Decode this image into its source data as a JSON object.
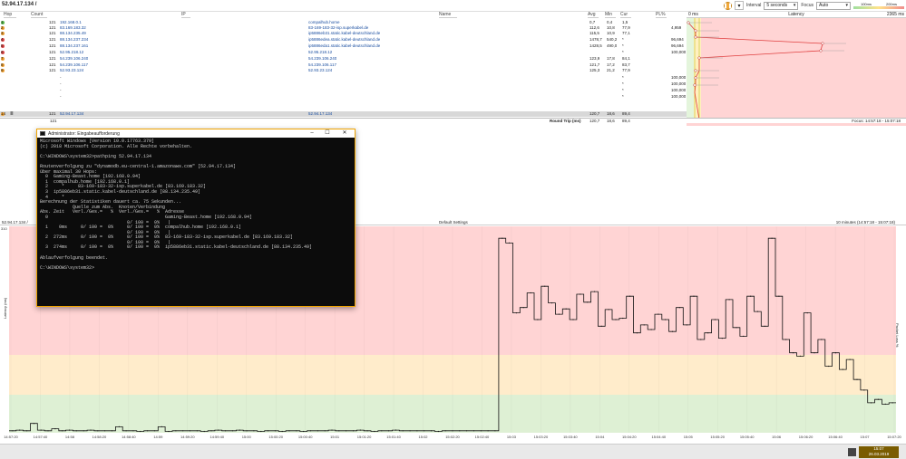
{
  "header": {
    "target": "52.94.17.134 /",
    "interval_label": "Interval",
    "interval_value": "5 seconds",
    "focus_label": "Focus",
    "focus_value": "Auto",
    "legend_ms_low": "100ms",
    "legend_ms_high": "200ms"
  },
  "columns": {
    "hop": "Hop",
    "count": "Count",
    "ip": "IP",
    "name": "Name",
    "avg": "Avg",
    "min": "Min",
    "cur": "Cur",
    "pl": "PL%",
    "lat_min": "0 ms",
    "latency": "Latency",
    "lat_max": "2365 ms"
  },
  "hops": [
    {
      "hop": "1",
      "count": "121",
      "ip": "192.168.0.1",
      "name": "compalhub.home",
      "avg": "0,7",
      "min": "0,4",
      "cur": "1,5",
      "pl": "",
      "status": "green"
    },
    {
      "hop": "2",
      "count": "121",
      "ip": "83.169.183.32",
      "name": "83-169-183-32-isp.superkabel.de",
      "avg": "112,6",
      "min": "10,8",
      "cur": "77,9",
      "pl": "4,959",
      "status": "orange"
    },
    {
      "hop": "3",
      "count": "121",
      "ip": "88.134.235.49",
      "name": "ip5886eb31.static.kabel-deutschland.de",
      "avg": "115,5",
      "min": "10,9",
      "cur": "77,1",
      "pl": "",
      "status": "orange"
    },
    {
      "hop": "4",
      "count": "121",
      "ip": "88.134.237.234",
      "name": "ip5886edea.static.kabel-deutschland.de",
      "avg": "1478,7",
      "min": "540,2",
      "cur": "*",
      "pl": "96,694",
      "status": "red"
    },
    {
      "hop": "5",
      "count": "121",
      "ip": "88.134.237.161",
      "name": "ip5886eda1.static.kabel-deutschland.de",
      "avg": "1428,5",
      "min": "490,0",
      "cur": "*",
      "pl": "96,694",
      "status": "red"
    },
    {
      "hop": "6",
      "count": "121",
      "ip": "52.95.218.12",
      "name": "52.95.218.12",
      "avg": "",
      "min": "",
      "cur": "*",
      "pl": "100,000",
      "status": "red"
    },
    {
      "hop": "7",
      "count": "121",
      "ip": "54.239.106.240",
      "name": "54.239.106.240",
      "avg": "123,9",
      "min": "17,8",
      "cur": "84,1",
      "pl": "",
      "status": "orange"
    },
    {
      "hop": "8",
      "count": "121",
      "ip": "54.239.106.117",
      "name": "54.239.106.117",
      "avg": "121,7",
      "min": "17,2",
      "cur": "83,7",
      "pl": "",
      "status": "orange"
    },
    {
      "hop": "9",
      "count": "121",
      "ip": "52.93.23.124",
      "name": "52.93.23.124",
      "avg": "125,3",
      "min": "21,2",
      "cur": "77,9",
      "pl": "",
      "status": "orange"
    },
    {
      "hop": "",
      "count": "",
      "ip": "-",
      "name": "",
      "avg": "",
      "min": "",
      "cur": "*",
      "pl": "100,000",
      "status": ""
    },
    {
      "hop": "",
      "count": "",
      "ip": "-",
      "name": "",
      "avg": "",
      "min": "",
      "cur": "*",
      "pl": "100,000",
      "status": ""
    },
    {
      "hop": "",
      "count": "",
      "ip": "-",
      "name": "",
      "avg": "",
      "min": "",
      "cur": "*",
      "pl": "100,000",
      "status": ""
    },
    {
      "hop": "",
      "count": "",
      "ip": "-",
      "name": "",
      "avg": "",
      "min": "",
      "cur": "*",
      "pl": "100,000",
      "status": ""
    },
    {
      "hop": "14",
      "count": "121",
      "ip": "52.94.17.134",
      "name": "52.94.17.134",
      "avg": "120,7",
      "min": "18,6",
      "cur": "89,4",
      "pl": "",
      "status": "orange"
    }
  ],
  "summary": {
    "count": "121",
    "label": "Round Trip (ms)",
    "avg": "120,7",
    "min": "18,6",
    "cur": "89,4",
    "focus": "Focus: 14:57:18 - 15:07:18"
  },
  "console": {
    "title": "Administrator: Eingabeaufforderung",
    "lines": [
      "Microsoft Windows [Version 10.0.17763.379]",
      "(c) 2018 Microsoft Corporation. Alle Rechte vorbehalten.",
      "",
      "C:\\WINDOWS\\system32>pathping 52.94.17.134",
      "",
      "Routenverfolgung zu \"dynamodb.eu-central-1.amazonaws.com\" [52.94.17.134]",
      "über maximal 30 Hops:",
      "  0  Gaming-Beast.home [192.168.0.94]",
      "  1  compalhub.home [192.168.0.1]",
      "  2     *     83-169-183-32-isp.superkabel.de [83.169.183.32]",
      "  3  ip5886eb31.static.kabel-deutschland.de [88.134.235.49]",
      "  4     *",
      "Berechnung der Statistiken dauert ca. 75 Sekunden...",
      "            Quelle zum Abs.  Knoten/Verbindung",
      "Abs. Zeit   Verl./Ges.=   %  Verl./Ges.=   %  Adresse",
      "  0                                           Gaming-Beast.home [192.168.0.94]",
      "                                0/ 100 =  0%   |",
      "  1    0ms     0/ 100 =  0%     0/ 100 =  0%  compalhub.home [192.168.0.1]",
      "                                0/ 100 =  0%   |",
      "  2  272ms     0/ 100 =  0%     0/ 100 =  0%  83-169-183-32-isp.superkabel.de [83.169.183.32]",
      "                                0/ 100 =  0%   |",
      "  3  274ms     0/ 100 =  0%     0/ 100 =  0%  ip5886eb31.static.kabel-deutschland.de [88.134.235.49]",
      "",
      "Ablaufverfolgung beendet.",
      "",
      "C:\\WINDOWS\\system32>"
    ]
  },
  "graph": {
    "target": "52.94.17.134 /",
    "settings": "Default Settings",
    "timespan": "10 minutes (14:57:18 - 15:07:18)",
    "ylabel": "Latency (ms)",
    "y2label": "Packet Loss %",
    "ytop": "310",
    "xticks": [
      "14:57:20",
      "14:57:40",
      "14:58",
      "14:58:20",
      "14:58:40",
      "14:59",
      "14:59:20",
      "14:59:40",
      "15:00",
      "15:00:20",
      "15:00:40",
      "15:01",
      "15:01:20",
      "15:01:40",
      "15:02",
      "15:02:20",
      "15:02:40",
      "15:03",
      "15:03:20",
      "15:03:40",
      "15:04",
      "15:04:20",
      "15:04:40",
      "15:05",
      "15:05:20",
      "15:05:40",
      "15:06",
      "15:06:20",
      "15:06:40",
      "15:07",
      "15:07:20"
    ]
  },
  "chart_data": {
    "type": "line",
    "ylim": [
      0,
      310
    ],
    "x": [
      "14:57:18",
      "14:57:23",
      "14:57:28",
      "14:57:33",
      "14:57:38",
      "14:57:43",
      "14:57:48",
      "14:57:53",
      "14:57:58",
      "14:58:03",
      "14:58:08",
      "14:58:13",
      "14:58:18",
      "14:58:23",
      "14:58:28",
      "14:58:33",
      "14:58:38",
      "14:58:43",
      "14:58:48",
      "14:58:53",
      "14:58:58",
      "14:59:03",
      "14:59:08",
      "14:59:13",
      "14:59:18",
      "14:59:23",
      "14:59:28",
      "14:59:33",
      "14:59:38",
      "14:59:43",
      "14:59:48",
      "14:59:53",
      "14:59:58",
      "15:00:03",
      "15:00:08",
      "15:00:13",
      "15:00:18",
      "15:00:23",
      "15:00:28",
      "15:00:33",
      "15:00:38",
      "15:00:43",
      "15:00:48",
      "15:00:53",
      "15:00:58",
      "15:01:03",
      "15:01:08",
      "15:01:13",
      "15:01:18",
      "15:01:23",
      "15:01:28",
      "15:01:33",
      "15:01:38",
      "15:01:43",
      "15:01:48",
      "15:01:53",
      "15:01:58",
      "15:02:03",
      "15:02:08",
      "15:02:13",
      "15:02:18",
      "15:02:23",
      "15:02:28",
      "15:02:33",
      "15:02:38",
      "15:02:43",
      "15:02:48",
      "15:02:53",
      "15:02:58",
      "15:03:03",
      "15:03:08",
      "15:03:13",
      "15:03:18",
      "15:03:23",
      "15:03:28",
      "15:03:33",
      "15:03:38",
      "15:03:43",
      "15:03:48",
      "15:03:53",
      "15:03:58",
      "15:04:03",
      "15:04:08",
      "15:04:13",
      "15:04:18",
      "15:04:23",
      "15:04:28",
      "15:04:33",
      "15:04:38",
      "15:04:43",
      "15:04:48",
      "15:04:53",
      "15:04:58",
      "15:05:03",
      "15:05:08",
      "15:05:13",
      "15:05:18",
      "15:05:23",
      "15:05:28",
      "15:05:33",
      "15:05:38",
      "15:05:43",
      "15:05:48",
      "15:05:53",
      "15:05:58",
      "15:06:03",
      "15:06:08",
      "15:06:13",
      "15:06:18",
      "15:06:23",
      "15:06:28",
      "15:06:33",
      "15:06:38",
      "15:06:43",
      "15:06:48",
      "15:06:53",
      "15:06:58",
      "15:07:03",
      "15:07:08",
      "15:07:13",
      "15:07:18"
    ],
    "series": [
      {
        "values": [
          3,
          4,
          3,
          14,
          4,
          3,
          6,
          3,
          4,
          3,
          3,
          4,
          3,
          3,
          3,
          9,
          3,
          3,
          2,
          3,
          3,
          9,
          2,
          3,
          3,
          3,
          3,
          2,
          3,
          4,
          3,
          3,
          4,
          3,
          3,
          2,
          3,
          3,
          2,
          3,
          3,
          2,
          3,
          3,
          3,
          4,
          3,
          3,
          3,
          4,
          3,
          2,
          3,
          3,
          4,
          3,
          3,
          3,
          3,
          3,
          2,
          3,
          3,
          3,
          3,
          3,
          3,
          3,
          3,
          292,
          285,
          180,
          188,
          210,
          170,
          220,
          195,
          178,
          186,
          170,
          208,
          196,
          212,
          160,
          185,
          170,
          172,
          205,
          150,
          162,
          155,
          178,
          170,
          152,
          188,
          162,
          205,
          140,
          150,
          170,
          142,
          200,
          158,
          145,
          205,
          182,
          160,
          292,
          205,
          140,
          120,
          115,
          180,
          120,
          140,
          100,
          120,
          95,
          110,
          80,
          64,
          45,
          50,
          43,
          45
        ]
      }
    ]
  }
}
